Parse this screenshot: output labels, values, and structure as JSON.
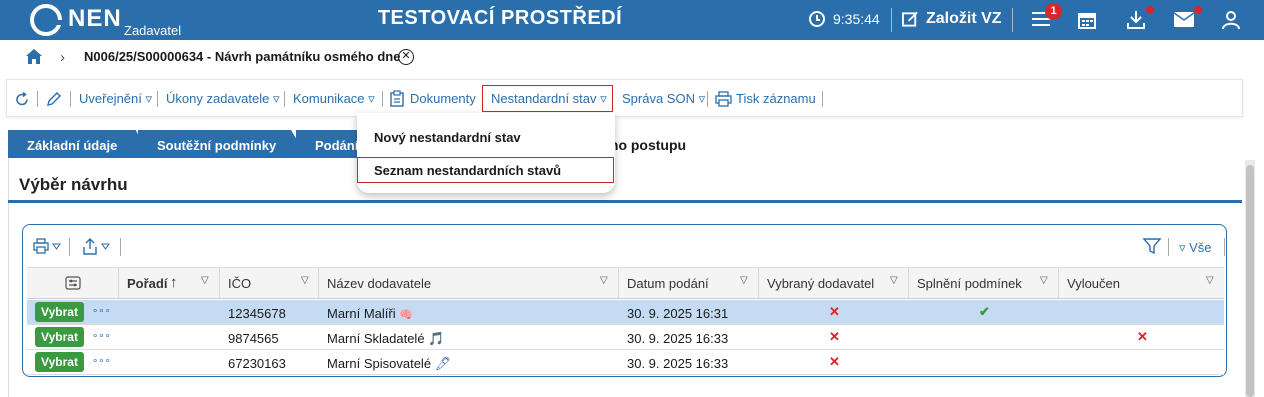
{
  "header": {
    "logo_text": "NEN",
    "logo_sub": "Zadavatel",
    "env_title": "TESTOVACÍ PROSTŘEDÍ",
    "clock_time": "9:35:44",
    "create_label": "Založit VZ",
    "menu_badge": "1"
  },
  "breadcrumb": {
    "title": "N006/25/S00000634 - Návrh památníku osmého dne"
  },
  "toolbar": {
    "items": [
      "Uveřejnění ▿",
      "Úkony zadavatele ▿",
      "Komunikace ▿",
      "Dokumenty",
      "Nestandardní stav ▿",
      "Správa SON ▿",
      "Tisk záznamu"
    ]
  },
  "dropdown": {
    "items": [
      "Nový nestandardní stav",
      "Seznam nestandardních stavů"
    ]
  },
  "tabs": {
    "zakladni": "Základní údaje",
    "soutez": "Soutěžní podmínky",
    "podani": "Podání",
    "active": "ího postupu"
  },
  "section": {
    "title": "Výběr návrhu"
  },
  "grid": {
    "all_label": "Vše",
    "columns": [
      "Pořadí",
      "IČO",
      "Název dodavatele",
      "Datum podání",
      "Vybraný dodavatel",
      "Splnění podmínek",
      "Vyloučen"
    ],
    "select_label": "Vybrat",
    "rows": [
      {
        "ico": "12345678",
        "name": "Marní Malíři",
        "date": "30. 9. 2025 16:31",
        "vybrany": "✕",
        "splneni": "✔",
        "vyloucen": "",
        "emoji": "🧠"
      },
      {
        "ico": "9874565",
        "name": "Marní Skladatelé",
        "date": "30. 9. 2025 16:33",
        "vybrany": "✕",
        "splneni": "",
        "vyloucen": "✕",
        "emoji": "🎵"
      },
      {
        "ico": "67230163",
        "name": "Marní Spisovatelé",
        "date": "30. 9. 2025 16:33",
        "vybrany": "✕",
        "splneni": "",
        "vyloucen": "",
        "emoji": "🖊"
      }
    ]
  },
  "colors": {
    "brand": "#2a6fab",
    "danger": "#c9272e",
    "success": "#3a9a3f",
    "selected_row": "#c5dbf3"
  }
}
